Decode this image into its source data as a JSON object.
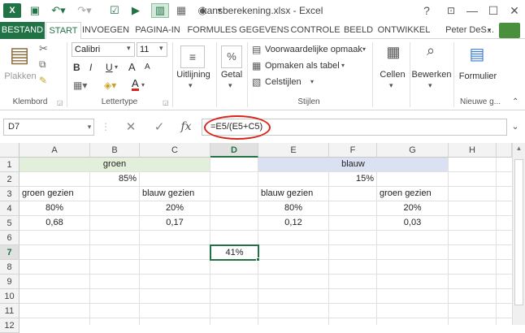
{
  "window": {
    "title": "kansberekening.xlsx - Excel"
  },
  "quick_access": [
    "save-icon",
    "undo-icon",
    "redo-icon",
    "spellcheck-icon",
    "form-icon",
    "camera-icon",
    "customize-icon"
  ],
  "window_buttons": {
    "help": "?",
    "minimize": "—",
    "restore": "☐",
    "close": "✕"
  },
  "tabs": [
    "BESTAND",
    "START",
    "INVOEGEN",
    "PAGINA-IN",
    "FORMULES",
    "GEGEVENS",
    "CONTROLE",
    "BEELD",
    "ONTWIKKEL"
  ],
  "user": "Peter DeS...",
  "ribbon": {
    "clipboard": {
      "paste": "Plakken",
      "group": "Klembord"
    },
    "font": {
      "name": "Calibri",
      "size": "11",
      "group": "Lettertype",
      "bold": "B",
      "italic": "I",
      "underline": "U",
      "grow": "A",
      "shrink": "A"
    },
    "alignment": {
      "label": "Uitlijning"
    },
    "number": {
      "label": "Getal",
      "icon_text": "%"
    },
    "styles": {
      "conditional": "Voorwaardelijke opmaak",
      "table": "Opmaken als tabel",
      "cell": "Celstijlen",
      "group": "Stijlen"
    },
    "cells": {
      "label": "Cellen"
    },
    "editing": {
      "label": "Bewerken"
    },
    "formulier": {
      "label": "Formulier",
      "group": "Nieuwe g..."
    }
  },
  "formula_bar": {
    "name_box": "D7",
    "fx": "fx",
    "formula": "=E5/(E5+C5)"
  },
  "columns": [
    "A",
    "B",
    "C",
    "D",
    "E",
    "F",
    "G",
    "H"
  ],
  "selected_column": "D",
  "rows": [
    "1",
    "2",
    "3",
    "4",
    "5",
    "6",
    "7",
    "8",
    "9",
    "10",
    "11",
    "12"
  ],
  "selected_row": "7",
  "cells": {
    "groen": "groen",
    "blauw": "blauw",
    "B2": "85%",
    "F2": "15%",
    "A3": "groen gezien",
    "C3": "blauw gezien",
    "E3": "blauw gezien",
    "G3": "groen gezien",
    "A4": "80%",
    "C4": "20%",
    "E4": "80%",
    "G4": "20%",
    "A5": "0,68",
    "C5": "0,17",
    "E5": "0,12",
    "G5": "0,03",
    "D7": "41%"
  },
  "colors": {
    "accent": "#217346",
    "groen_fill": "#e2efda",
    "blauw_fill": "#d9e1f2",
    "annotation": "#d9241c"
  }
}
